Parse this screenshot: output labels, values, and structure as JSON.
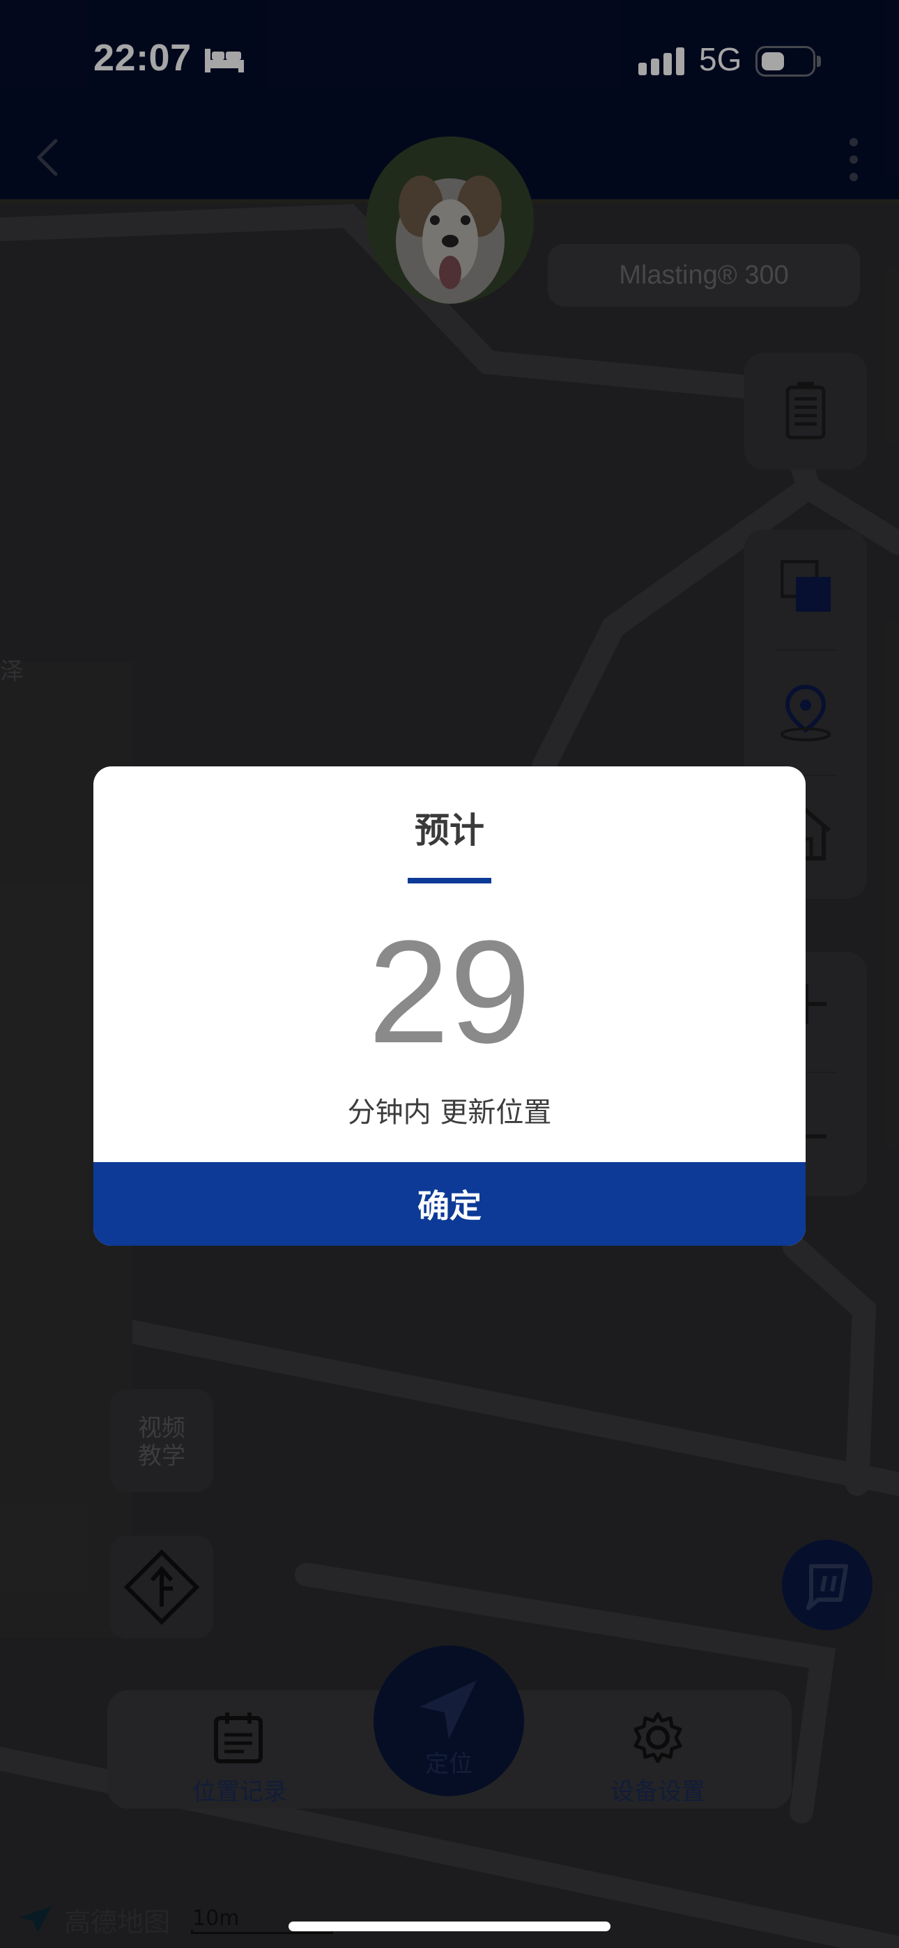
{
  "status_bar": {
    "time": "22:07",
    "network": "5G"
  },
  "header": {
    "back_icon": "chevron-left-icon",
    "more_icon": "more-vertical-icon"
  },
  "device": {
    "name": "Mlasting® 300"
  },
  "left_buttons": {
    "video_tutorial": "视频\n教学"
  },
  "bottom_nav": {
    "history_label": "位置记录",
    "locate_label": "定位",
    "settings_label": "设备设置"
  },
  "map": {
    "provider": "高德地图",
    "scale_label": "10m",
    "side_label": "泽"
  },
  "dialog": {
    "title": "预计",
    "minutes": "29",
    "message": "分钟内 更新位置",
    "confirm_label": "确定"
  },
  "colors": {
    "brand": "#0c3a96",
    "header_bg": "#040d2b",
    "map_bg": "#2c2c2e"
  }
}
